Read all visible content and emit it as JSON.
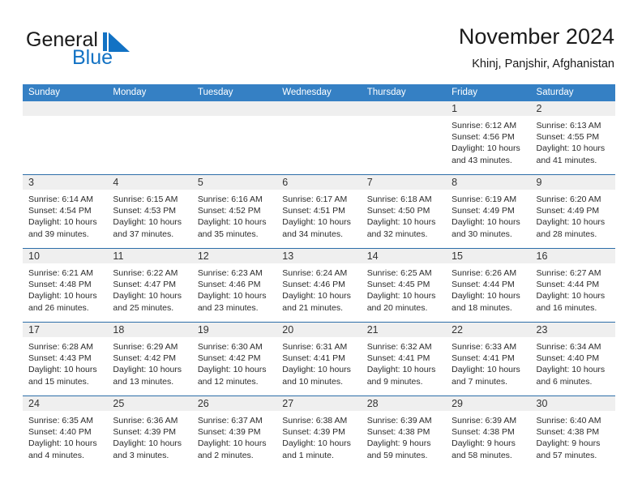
{
  "brand": {
    "word_general": "General",
    "word_blue": "Blue",
    "logo_icon": "generalblue-flag-icon",
    "accent_color": "#1272c4"
  },
  "header": {
    "title": "November 2024",
    "subtitle": "Khinj, Panjshir, Afghanistan"
  },
  "theme": {
    "header_row_bg": "#3580c4",
    "row_divider": "#2d6ea8",
    "daynum_band_bg": "#efefef",
    "text": "#2b2b2b"
  },
  "weekday_headers": [
    "Sunday",
    "Monday",
    "Tuesday",
    "Wednesday",
    "Thursday",
    "Friday",
    "Saturday"
  ],
  "weeks": [
    [
      {
        "day": "",
        "sunrise": "",
        "sunset": "",
        "daylight_a": "",
        "daylight_b": ""
      },
      {
        "day": "",
        "sunrise": "",
        "sunset": "",
        "daylight_a": "",
        "daylight_b": ""
      },
      {
        "day": "",
        "sunrise": "",
        "sunset": "",
        "daylight_a": "",
        "daylight_b": ""
      },
      {
        "day": "",
        "sunrise": "",
        "sunset": "",
        "daylight_a": "",
        "daylight_b": ""
      },
      {
        "day": "",
        "sunrise": "",
        "sunset": "",
        "daylight_a": "",
        "daylight_b": ""
      },
      {
        "day": "1",
        "sunrise": "Sunrise: 6:12 AM",
        "sunset": "Sunset: 4:56 PM",
        "daylight_a": "Daylight: 10 hours",
        "daylight_b": "and 43 minutes."
      },
      {
        "day": "2",
        "sunrise": "Sunrise: 6:13 AM",
        "sunset": "Sunset: 4:55 PM",
        "daylight_a": "Daylight: 10 hours",
        "daylight_b": "and 41 minutes."
      }
    ],
    [
      {
        "day": "3",
        "sunrise": "Sunrise: 6:14 AM",
        "sunset": "Sunset: 4:54 PM",
        "daylight_a": "Daylight: 10 hours",
        "daylight_b": "and 39 minutes."
      },
      {
        "day": "4",
        "sunrise": "Sunrise: 6:15 AM",
        "sunset": "Sunset: 4:53 PM",
        "daylight_a": "Daylight: 10 hours",
        "daylight_b": "and 37 minutes."
      },
      {
        "day": "5",
        "sunrise": "Sunrise: 6:16 AM",
        "sunset": "Sunset: 4:52 PM",
        "daylight_a": "Daylight: 10 hours",
        "daylight_b": "and 35 minutes."
      },
      {
        "day": "6",
        "sunrise": "Sunrise: 6:17 AM",
        "sunset": "Sunset: 4:51 PM",
        "daylight_a": "Daylight: 10 hours",
        "daylight_b": "and 34 minutes."
      },
      {
        "day": "7",
        "sunrise": "Sunrise: 6:18 AM",
        "sunset": "Sunset: 4:50 PM",
        "daylight_a": "Daylight: 10 hours",
        "daylight_b": "and 32 minutes."
      },
      {
        "day": "8",
        "sunrise": "Sunrise: 6:19 AM",
        "sunset": "Sunset: 4:49 PM",
        "daylight_a": "Daylight: 10 hours",
        "daylight_b": "and 30 minutes."
      },
      {
        "day": "9",
        "sunrise": "Sunrise: 6:20 AM",
        "sunset": "Sunset: 4:49 PM",
        "daylight_a": "Daylight: 10 hours",
        "daylight_b": "and 28 minutes."
      }
    ],
    [
      {
        "day": "10",
        "sunrise": "Sunrise: 6:21 AM",
        "sunset": "Sunset: 4:48 PM",
        "daylight_a": "Daylight: 10 hours",
        "daylight_b": "and 26 minutes."
      },
      {
        "day": "11",
        "sunrise": "Sunrise: 6:22 AM",
        "sunset": "Sunset: 4:47 PM",
        "daylight_a": "Daylight: 10 hours",
        "daylight_b": "and 25 minutes."
      },
      {
        "day": "12",
        "sunrise": "Sunrise: 6:23 AM",
        "sunset": "Sunset: 4:46 PM",
        "daylight_a": "Daylight: 10 hours",
        "daylight_b": "and 23 minutes."
      },
      {
        "day": "13",
        "sunrise": "Sunrise: 6:24 AM",
        "sunset": "Sunset: 4:46 PM",
        "daylight_a": "Daylight: 10 hours",
        "daylight_b": "and 21 minutes."
      },
      {
        "day": "14",
        "sunrise": "Sunrise: 6:25 AM",
        "sunset": "Sunset: 4:45 PM",
        "daylight_a": "Daylight: 10 hours",
        "daylight_b": "and 20 minutes."
      },
      {
        "day": "15",
        "sunrise": "Sunrise: 6:26 AM",
        "sunset": "Sunset: 4:44 PM",
        "daylight_a": "Daylight: 10 hours",
        "daylight_b": "and 18 minutes."
      },
      {
        "day": "16",
        "sunrise": "Sunrise: 6:27 AM",
        "sunset": "Sunset: 4:44 PM",
        "daylight_a": "Daylight: 10 hours",
        "daylight_b": "and 16 minutes."
      }
    ],
    [
      {
        "day": "17",
        "sunrise": "Sunrise: 6:28 AM",
        "sunset": "Sunset: 4:43 PM",
        "daylight_a": "Daylight: 10 hours",
        "daylight_b": "and 15 minutes."
      },
      {
        "day": "18",
        "sunrise": "Sunrise: 6:29 AM",
        "sunset": "Sunset: 4:42 PM",
        "daylight_a": "Daylight: 10 hours",
        "daylight_b": "and 13 minutes."
      },
      {
        "day": "19",
        "sunrise": "Sunrise: 6:30 AM",
        "sunset": "Sunset: 4:42 PM",
        "daylight_a": "Daylight: 10 hours",
        "daylight_b": "and 12 minutes."
      },
      {
        "day": "20",
        "sunrise": "Sunrise: 6:31 AM",
        "sunset": "Sunset: 4:41 PM",
        "daylight_a": "Daylight: 10 hours",
        "daylight_b": "and 10 minutes."
      },
      {
        "day": "21",
        "sunrise": "Sunrise: 6:32 AM",
        "sunset": "Sunset: 4:41 PM",
        "daylight_a": "Daylight: 10 hours",
        "daylight_b": "and 9 minutes."
      },
      {
        "day": "22",
        "sunrise": "Sunrise: 6:33 AM",
        "sunset": "Sunset: 4:41 PM",
        "daylight_a": "Daylight: 10 hours",
        "daylight_b": "and 7 minutes."
      },
      {
        "day": "23",
        "sunrise": "Sunrise: 6:34 AM",
        "sunset": "Sunset: 4:40 PM",
        "daylight_a": "Daylight: 10 hours",
        "daylight_b": "and 6 minutes."
      }
    ],
    [
      {
        "day": "24",
        "sunrise": "Sunrise: 6:35 AM",
        "sunset": "Sunset: 4:40 PM",
        "daylight_a": "Daylight: 10 hours",
        "daylight_b": "and 4 minutes."
      },
      {
        "day": "25",
        "sunrise": "Sunrise: 6:36 AM",
        "sunset": "Sunset: 4:39 PM",
        "daylight_a": "Daylight: 10 hours",
        "daylight_b": "and 3 minutes."
      },
      {
        "day": "26",
        "sunrise": "Sunrise: 6:37 AM",
        "sunset": "Sunset: 4:39 PM",
        "daylight_a": "Daylight: 10 hours",
        "daylight_b": "and 2 minutes."
      },
      {
        "day": "27",
        "sunrise": "Sunrise: 6:38 AM",
        "sunset": "Sunset: 4:39 PM",
        "daylight_a": "Daylight: 10 hours",
        "daylight_b": "and 1 minute."
      },
      {
        "day": "28",
        "sunrise": "Sunrise: 6:39 AM",
        "sunset": "Sunset: 4:38 PM",
        "daylight_a": "Daylight: 9 hours",
        "daylight_b": "and 59 minutes."
      },
      {
        "day": "29",
        "sunrise": "Sunrise: 6:39 AM",
        "sunset": "Sunset: 4:38 PM",
        "daylight_a": "Daylight: 9 hours",
        "daylight_b": "and 58 minutes."
      },
      {
        "day": "30",
        "sunrise": "Sunrise: 6:40 AM",
        "sunset": "Sunset: 4:38 PM",
        "daylight_a": "Daylight: 9 hours",
        "daylight_b": "and 57 minutes."
      }
    ]
  ]
}
